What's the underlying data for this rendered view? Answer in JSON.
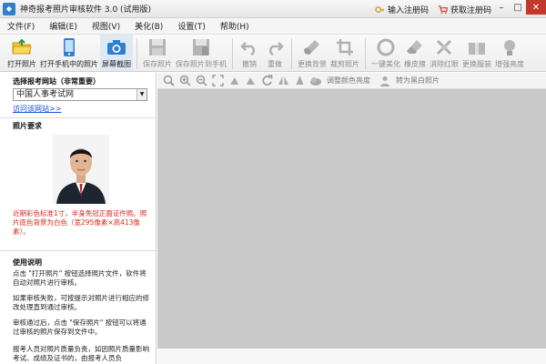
{
  "window": {
    "title": "神奇报考照片审核软件 3.0 (试用版)",
    "links": [
      {
        "label": "输入注册码",
        "icon": "key-icon"
      },
      {
        "label": "获取注册码",
        "icon": "cart-icon"
      }
    ]
  },
  "menu": [
    "文件(F)",
    "编辑(E)",
    "视图(V)",
    "美化(B)",
    "设置(T)",
    "帮助(H)"
  ],
  "toolbar": {
    "buttons": [
      {
        "label": "打开照片",
        "icon": "folder-open-icon",
        "enabled": true
      },
      {
        "label": "打开手机中的照片",
        "icon": "phone-icon",
        "enabled": true
      },
      {
        "label": "屏幕截图",
        "icon": "camera-icon",
        "enabled": true
      },
      {
        "label": "保存照片",
        "icon": "save-icon",
        "enabled": false
      },
      {
        "label": "保存照片到手机",
        "icon": "save-to-phone-icon",
        "enabled": false
      },
      {
        "label": "撤销",
        "icon": "undo-icon",
        "enabled": false
      },
      {
        "label": "重做",
        "icon": "redo-icon",
        "enabled": false
      },
      {
        "label": "更换背景",
        "icon": "background-brush-icon",
        "enabled": false
      },
      {
        "label": "裁剪照片",
        "icon": "crop-icon",
        "enabled": false
      },
      {
        "label": "一键美化",
        "icon": "beautify-icon",
        "enabled": false
      },
      {
        "label": "橡皮擦",
        "icon": "eraser-icon",
        "enabled": false
      },
      {
        "label": "消除红眼",
        "icon": "red-eye-icon",
        "enabled": false
      },
      {
        "label": "更换服装",
        "icon": "clothes-icon",
        "enabled": false
      },
      {
        "label": "增强亮度",
        "icon": "brightness-icon",
        "enabled": false
      }
    ]
  },
  "left_panel": {
    "site_section_title": "选择报考网站（非常重要）",
    "site_selected": "中国人事考试网",
    "visit_link": "访问该网站>>",
    "photo_req_title": "照片要求",
    "photo_req_text": "近期彩色标准1寸，半身免冠正面证件照。照片底色背景为白色（宽295像素×高413像素）。",
    "usage_title": "使用说明",
    "usage_paragraphs": [
      "点击 \"打开照片\" 按钮选择照片文件，软件将自动对照片进行审核。",
      "如果审核失败，可按提示对照片进行相应的修改处理直到通过审核。",
      "审核通过后，点击 \"保存照片\" 按钮可以将通过审核的照片保存到文件中。",
      "报考人员对照片质量负责，如因照片质量影响考试、成绩及证书的，由报考人员负"
    ]
  },
  "view_toolbar": {
    "icons": [
      "zoom-fit-icon",
      "zoom-in-icon",
      "zoom-out-icon",
      "actual-size-icon",
      "rotate-left-icon",
      "rotate-right-icon",
      "refresh-icon",
      "flip-horizontal-icon",
      "flip-vertical-icon"
    ],
    "adjust_color_label": "调整颜色亮度",
    "to_bw_label": "转为黑白照片"
  },
  "colors": {
    "accent": "#2e7fd0",
    "warning_text": "#d9261c",
    "canvas_bg": "#c9c9c9"
  }
}
